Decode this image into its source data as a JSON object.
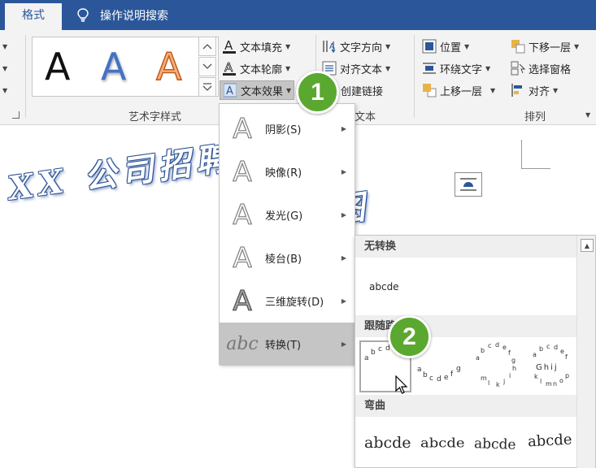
{
  "tabs": {
    "active": "格式",
    "tell_me": "操作说明搜索"
  },
  "ribbon": {
    "wordart_group_label": "艺术字样式",
    "text_group_label": "文本",
    "arrange_group_label": "排列",
    "gallery_letters": [
      "A",
      "A",
      "A"
    ],
    "text_fill": "文本填充",
    "text_outline": "文本轮廓",
    "text_effects": "文本效果",
    "text_direction": "文字方向",
    "align_text": "对齐文本",
    "create_link": "创建链接",
    "position": "位置",
    "wrap_text": "环绕文字",
    "bring_forward": "上移一层",
    "send_backward": "下移一层",
    "selection_pane": "选择窗格",
    "align": "对齐"
  },
  "document": {
    "wordart_text": "XX 公司招聘",
    "wordart_tail": "图"
  },
  "effects_menu": {
    "items": [
      {
        "label": "阴影(S)",
        "icon": "shadow-a-icon"
      },
      {
        "label": "映像(R)",
        "icon": "reflection-a-icon"
      },
      {
        "label": "发光(G)",
        "icon": "glow-a-icon"
      },
      {
        "label": "棱台(B)",
        "icon": "bevel-a-icon"
      },
      {
        "label": "三维旋转(D)",
        "icon": "3d-rotation-a-icon"
      },
      {
        "label": "转换(T)",
        "icon": "transform-abc-icon"
      }
    ],
    "transform_glyph": "abc"
  },
  "transform_gallery": {
    "no_transform_header": "无转换",
    "no_transform_sample": "abcde",
    "follow_path_header": "跟随路径",
    "warp_header": "弯曲",
    "warp_samples": [
      "abcde",
      "abcde",
      "abcde",
      "abcde"
    ]
  },
  "callouts": [
    "1",
    "2"
  ]
}
